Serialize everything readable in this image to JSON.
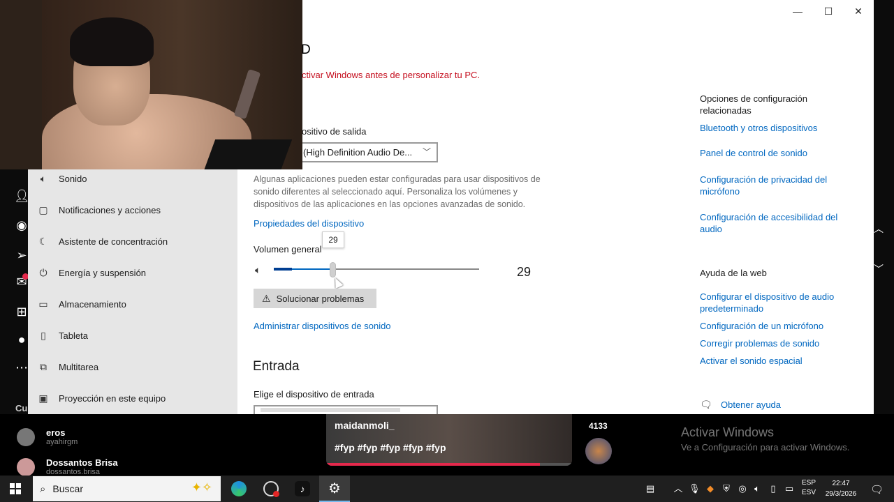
{
  "settings": {
    "title_fragment": "D",
    "activate_message": "ctivar Windows antes de personalizar tu PC.",
    "output_device_label": "ositivo de salida",
    "output_device_value": "(High Definition Audio De...",
    "apps_note": "Algunas aplicaciones pueden estar configuradas para usar dispositivos de sonido diferentes al seleccionado aquí. Personaliza los volúmenes y dispositivos de las aplicaciones en las opciones avanzadas de sonido.",
    "device_properties_link": "Propiedades del dispositivo",
    "master_volume_label": "Volumen general",
    "volume_value": "29",
    "volume_level": 29,
    "troubleshoot_button": "Solucionar problemas",
    "manage_devices_link": "Administrar dispositivos de sonido",
    "input_section_title": "Entrada",
    "input_device_label": "Elige el dispositivo de entrada",
    "window_controls": {
      "minimize": "—",
      "maximize": "☐",
      "close": "✕"
    },
    "sidebar": [
      {
        "label": "Sonido",
        "icon": "speaker-icon",
        "glyph": "🔈︎"
      },
      {
        "label": "Notificaciones y acciones",
        "icon": "notification-icon",
        "glyph": "▢"
      },
      {
        "label": "Asistente de concentración",
        "icon": "moon-icon",
        "glyph": "☾"
      },
      {
        "label": "Energía y suspensión",
        "icon": "power-icon",
        "glyph": "⏻"
      },
      {
        "label": "Almacenamiento",
        "icon": "storage-icon",
        "glyph": "▭"
      },
      {
        "label": "Tableta",
        "icon": "tablet-icon",
        "glyph": "▯"
      },
      {
        "label": "Multitarea",
        "icon": "multitask-icon",
        "glyph": "⧉"
      },
      {
        "label": "Proyección en este equipo",
        "icon": "projection-icon",
        "glyph": "▣"
      }
    ],
    "related": {
      "heading": "Opciones de configuración relacionadas",
      "links": [
        "Bluetooth y otros dispositivos",
        "Panel de control de sonido",
        "Configuración de privacidad del micrófono",
        "Configuración de accesibilidad del audio"
      ]
    },
    "web_help": {
      "heading": "Ayuda de la web",
      "links": [
        "Configurar el dispositivo de audio predeterminado",
        "Configuración de un micrófono",
        "Corregir problemas de sonido",
        "Activar el sonido espacial"
      ]
    },
    "get_help": "Obtener ayuda"
  },
  "tiktok": {
    "section_label": "Cu",
    "following": [
      {
        "name": "eros",
        "handle": "ayahirgm"
      },
      {
        "name": "Dossantos Brisa",
        "handle": "dossantos.brisa"
      }
    ],
    "video": {
      "username": "maidanmoli_",
      "caption": "#fyp #fyp #fyp #fyp #fyp",
      "progress": 0.87
    },
    "like_count": "4133"
  },
  "watermark": {
    "title": "Activar Windows",
    "subtitle": "Ve a Configuración para activar Windows."
  },
  "taskbar": {
    "search_placeholder": "Buscar",
    "language_top": "ESP",
    "language_bottom": "ESV",
    "time": "22:47",
    "date": "29/3/2026"
  },
  "colors": {
    "accent": "#0067c0",
    "warning": "#c50f1f",
    "sidebar_bg": "#e6e6e6",
    "taskbar_bg": "#1f1f1f"
  }
}
